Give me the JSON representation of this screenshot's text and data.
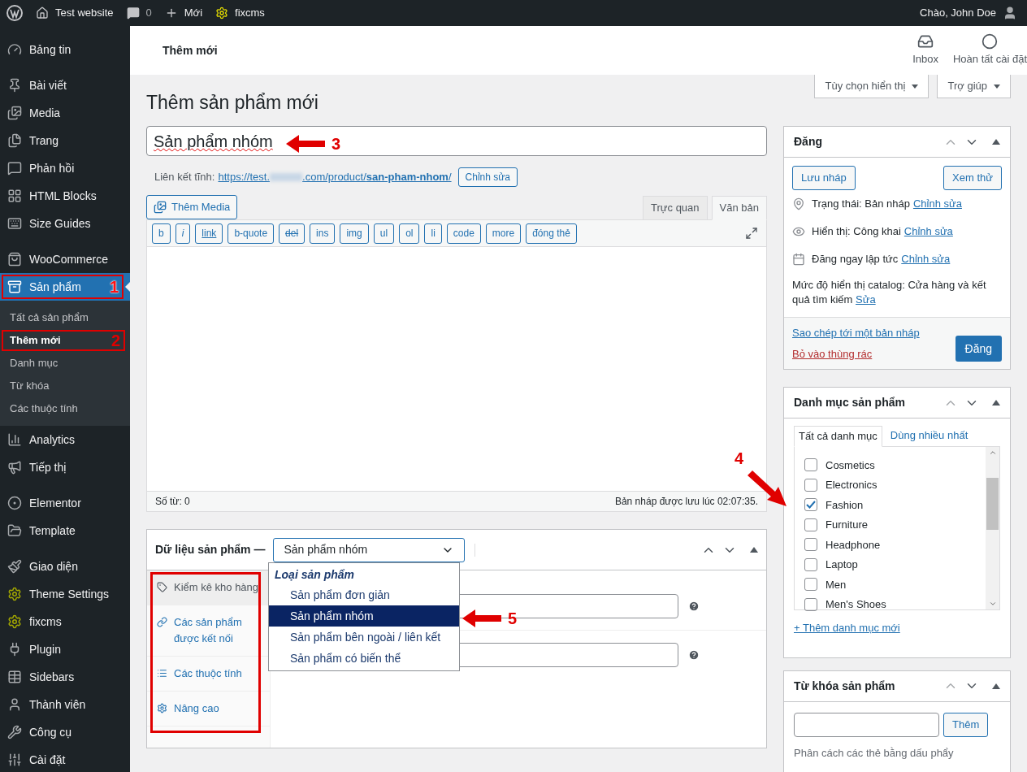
{
  "admin_bar": {
    "site": "Test website",
    "comments": "0",
    "new": "Mới",
    "plugin": "fixcms",
    "greeting": "Chào, John Doe"
  },
  "page_header": {
    "title": "Thêm mới",
    "actions": [
      {
        "label": "Inbox"
      },
      {
        "label": "Hoàn tất cài đặt"
      }
    ]
  },
  "screen_buttons": [
    "Tùy chọn hiển thị",
    "Trợ giúp"
  ],
  "sidebar": {
    "groups": [
      [
        {
          "label": "Bảng tin",
          "selected": false
        }
      ],
      [
        {
          "label": "Bài viết",
          "selected": false
        },
        {
          "label": "Media",
          "selected": false
        },
        {
          "label": "Trang",
          "selected": false
        },
        {
          "label": "Phản hồi",
          "selected": false
        },
        {
          "label": "HTML Blocks",
          "selected": false
        },
        {
          "label": "Size Guides",
          "selected": false
        }
      ],
      [
        {
          "label": "WooCommerce",
          "selected": false
        },
        {
          "label": "Sản phẩm",
          "selected": true,
          "callout": "1",
          "submenu": [
            {
              "label": "Tất cả sản phẩm",
              "selected": false
            },
            {
              "label": "Thêm mới",
              "selected": true,
              "callout": "2"
            },
            {
              "label": "Danh mục",
              "selected": false
            },
            {
              "label": "Từ khóa",
              "selected": false
            },
            {
              "label": "Các thuộc tính",
              "selected": false
            }
          ]
        },
        {
          "label": "Analytics",
          "selected": false
        },
        {
          "label": "Tiếp thị",
          "selected": false
        }
      ],
      [
        {
          "label": "Elementor",
          "selected": false
        },
        {
          "label": "Template",
          "selected": false
        }
      ],
      [
        {
          "label": "Giao diện",
          "selected": false
        },
        {
          "label": "Theme Settings",
          "selected": false
        },
        {
          "label": "fixcms",
          "selected": false
        },
        {
          "label": "Plugin",
          "selected": false
        },
        {
          "label": "Sidebars",
          "selected": false
        },
        {
          "label": "Thành viên",
          "selected": false
        },
        {
          "label": "Công cụ",
          "selected": false
        },
        {
          "label": "Cài đặt",
          "selected": false
        }
      ]
    ]
  },
  "heading": "Thêm sản phẩm mới",
  "title_field": {
    "value": "Sản phẩm nhóm",
    "callout": "3"
  },
  "permalink": {
    "label": "Liên kết tĩnh:",
    "url_prefix": "https://test.",
    "url_suffix": ".com/product/**san-pham-nhom**/",
    "edit_button": "Chỉnh sửa"
  },
  "editor": {
    "add_media": "Thêm Media",
    "tabs": [
      {
        "label": "Trực quan",
        "selected": false
      },
      {
        "label": "Văn bản",
        "selected": true
      }
    ],
    "quicktags": [
      {
        "label": "b",
        "kind": "plain"
      },
      {
        "label": "i",
        "kind": "italic"
      },
      {
        "label": "link",
        "kind": "underline"
      },
      {
        "label": "b-quote",
        "kind": "plain"
      },
      {
        "label": "del",
        "kind": "strike"
      },
      {
        "label": "ins",
        "kind": "plain"
      },
      {
        "label": "img",
        "kind": "plain"
      },
      {
        "label": "ul",
        "kind": "plain"
      },
      {
        "label": "ol",
        "kind": "plain"
      },
      {
        "label": "li",
        "kind": "plain"
      },
      {
        "label": "code",
        "kind": "plain"
      },
      {
        "label": "more",
        "kind": "plain"
      },
      {
        "label": "đóng thẻ",
        "kind": "plain"
      }
    ],
    "word_count": "Số từ: 0",
    "saved": "Bản nháp được lưu lúc 02:07:35."
  },
  "product_data": {
    "title": "Dữ liệu sản phẩm —",
    "select_value": "Sản phẩm nhóm",
    "dropdown": {
      "group": "Loại sản phẩm",
      "options": [
        {
          "label": "Sản phẩm đơn giản",
          "selected": false
        },
        {
          "label": "Sản phẩm nhóm",
          "selected": true,
          "callout": "5"
        },
        {
          "label": "Sản phẩm bên ngoài / liên kết",
          "selected": false
        },
        {
          "label": "Sản phẩm có biến thể",
          "selected": false
        }
      ]
    },
    "tabs_outlined": true,
    "tabs": [
      {
        "label": "Kiểm kê kho hàng",
        "selected": true
      },
      {
        "label": "Các sản phẩm được kết nối",
        "selected": false
      },
      {
        "label": "Các thuộc tính",
        "selected": false
      },
      {
        "label": "Nâng cao",
        "selected": false
      }
    ]
  },
  "publish": {
    "title": "Đăng",
    "save_draft": "Lưu nháp",
    "preview": "Xem thử",
    "rows": [
      {
        "text": "Trạng thái: Bản nháp",
        "link": "Chỉnh sửa"
      },
      {
        "text": "Hiển thị: Công khai",
        "link": "Chỉnh sửa"
      },
      {
        "text": "Đăng ngay lập tức",
        "link": "Chỉnh sửa"
      }
    ],
    "catalog": "Mức độ hiển thị catalog: Cửa hàng và kết quả tìm kiếm",
    "catalog_link": "Sửa",
    "copy_link": "Sao chép tới một bản nháp",
    "trash_link": "Bỏ vào thùng rác",
    "publish_button": "Đăng"
  },
  "categories": {
    "title": "Danh mục sản phẩm",
    "tabs": [
      {
        "label": "Tất cả danh mục",
        "selected": true
      },
      {
        "label": "Dùng nhiều nhất",
        "selected": false
      }
    ],
    "items": [
      {
        "label": "Cosmetics",
        "checked": false
      },
      {
        "label": "Electronics",
        "checked": false
      },
      {
        "label": "Fashion",
        "checked": true,
        "callout": "4"
      },
      {
        "label": "Furniture",
        "checked": false
      },
      {
        "label": "Headphone",
        "checked": false
      },
      {
        "label": "Laptop",
        "checked": false
      },
      {
        "label": "Men",
        "checked": false
      },
      {
        "label": "Men's Shoes",
        "checked": false
      }
    ],
    "add_link": "+ Thêm danh mục mới"
  },
  "tags": {
    "title": "Từ khóa sản phẩm",
    "add_button": "Thêm",
    "hint": "Phân cách các thẻ bằng dấu phẩy"
  }
}
